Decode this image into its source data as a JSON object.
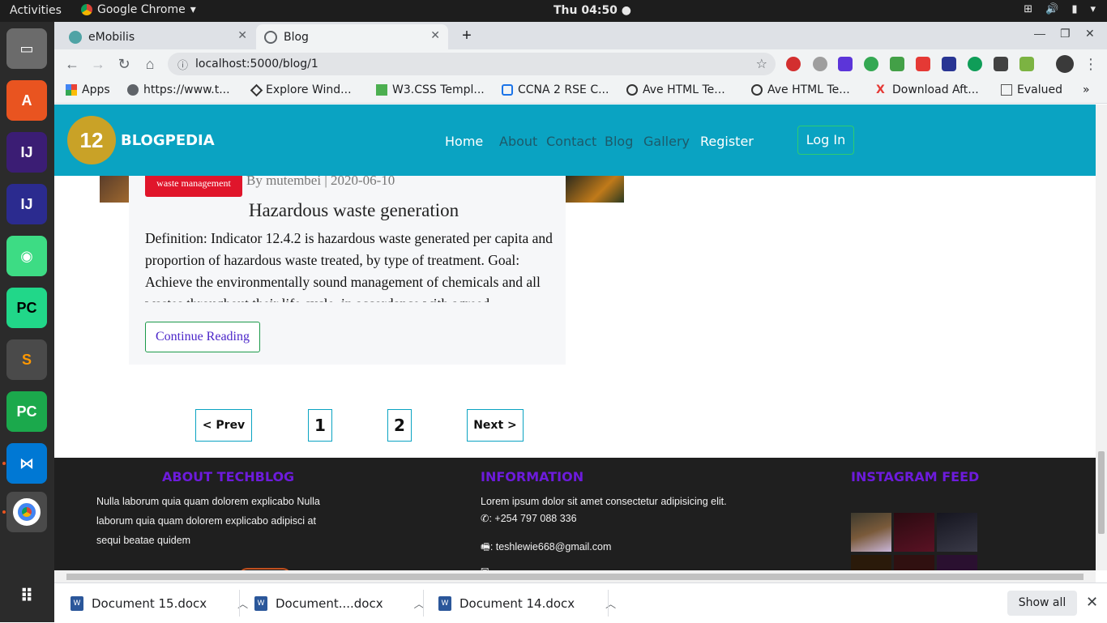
{
  "system": {
    "activities": "Activities",
    "app_name": "Google Chrome",
    "clock": "Thu 04:50 ●"
  },
  "browser": {
    "tabs": [
      {
        "title": "eMobilis",
        "active": false
      },
      {
        "title": "Blog",
        "active": true
      }
    ],
    "url": "localhost:5000/blog/1",
    "bookmarks": [
      {
        "label": "Apps"
      },
      {
        "label": "https://www.t..."
      },
      {
        "label": "Explore Wind..."
      },
      {
        "label": "W3.CSS Templ..."
      },
      {
        "label": "CCNA 2 RSE C..."
      },
      {
        "label": "Ave HTML Te..."
      },
      {
        "label": "Ave HTML Te..."
      },
      {
        "label": "Download Aft..."
      },
      {
        "label": "Evalued"
      }
    ],
    "overflow": "»"
  },
  "site": {
    "brand": "BLOGPEDIA",
    "logo_text": "12",
    "nav": [
      "Home",
      "About",
      "Contact",
      "Blog",
      "Gallery",
      "Register"
    ],
    "login": "Log In"
  },
  "post": {
    "tag": "waste management",
    "byline": "By mutembei | 2020-06-10",
    "title": "Hazardous waste generation",
    "excerpt": "Definition: Indicator 12.4.2 is hazardous waste generated per capita and proportion of hazardous waste treated, by type of treatment. Goal: Achieve the environmentally sound management of chemicals and all wastes throughout their life cycle, in accordance with agreed",
    "continue": "Continue Reading"
  },
  "pagination": {
    "prev": "< Prev",
    "pages": [
      "1",
      "2"
    ],
    "next": "Next >"
  },
  "footer": {
    "about_title": "ABOUT TECHBLOG",
    "about_text": "Nulla laborum quia quam dolorem explicabo Nulla laborum quia quam dolorem explicabo adipisci at sequi beatae quidem",
    "info_title": "INFORMATION",
    "info_text": "Lorem ipsum dolor sit amet consectetur adipisicing elit.",
    "phone": ": +254 797 088 336",
    "email": ": teshlewie668@gmail.com",
    "insta_title": "INSTAGRAM FEED"
  },
  "downloads": {
    "items": [
      "Document 15.docx",
      "Document....docx",
      "Document 14.docx"
    ],
    "show_all": "Show all"
  },
  "colors": {
    "nav_bg": "#0aa3c2",
    "tag_bg": "#e0152b",
    "footer_bg": "#1f1f1f",
    "footer_heading": "#6d1bdc"
  }
}
